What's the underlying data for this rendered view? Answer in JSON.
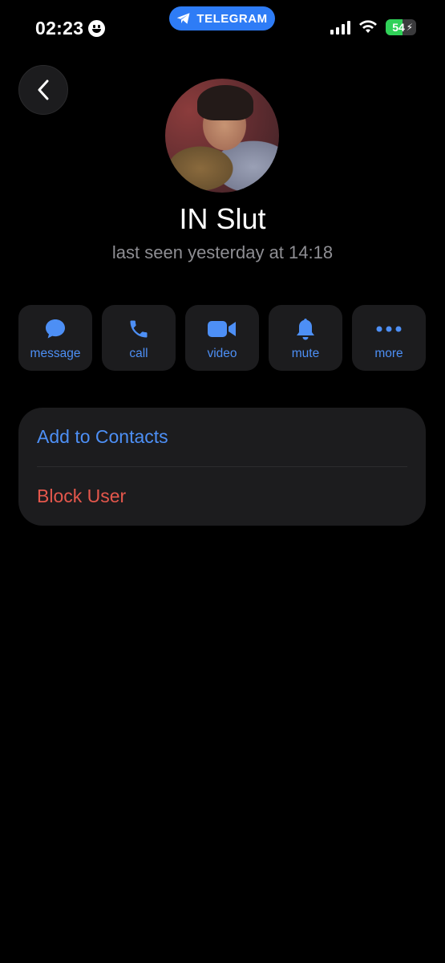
{
  "status_bar": {
    "time": "02:23",
    "emoji_icon": "grinning-face-icon",
    "app_pill": "TELEGRAM",
    "battery": "54",
    "battery_level_percent": 54
  },
  "profile": {
    "name": "IN Slut",
    "status": "last seen yesterday at 14:18"
  },
  "actions": [
    {
      "label": "message",
      "icon": "chat-bubble-icon"
    },
    {
      "label": "call",
      "icon": "phone-icon"
    },
    {
      "label": "video",
      "icon": "video-camera-icon"
    },
    {
      "label": "mute",
      "icon": "bell-icon"
    },
    {
      "label": "more",
      "icon": "ellipsis-icon"
    }
  ],
  "options": {
    "add_contact": "Add to Contacts",
    "block_user": "Block User"
  },
  "colors": {
    "accent": "#4d8ff5",
    "destructive": "#e5574c",
    "pill": "#2e7cf6",
    "battery_fill": "#30d158"
  }
}
